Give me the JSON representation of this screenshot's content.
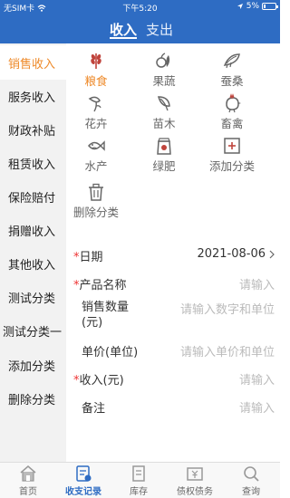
{
  "status_bar": {
    "carrier": "无SIM卡",
    "time": "下午5:20",
    "battery": "5%"
  },
  "header": {
    "tabs": [
      {
        "label": "收入",
        "active": true
      },
      {
        "label": "支出",
        "active": false
      }
    ]
  },
  "sidebar": {
    "items": [
      {
        "label": "销售收入",
        "active": true
      },
      {
        "label": "服务收入"
      },
      {
        "label": "财政补贴"
      },
      {
        "label": "租赁收入"
      },
      {
        "label": "保险赔付"
      },
      {
        "label": "捐赠收入"
      },
      {
        "label": "其他收入"
      },
      {
        "label": "测试分类"
      },
      {
        "label": "测试分类一"
      },
      {
        "label": "添加分类"
      },
      {
        "label": "删除分类"
      }
    ]
  },
  "categories": [
    {
      "label": "粮食",
      "icon": "grain-icon",
      "active": true
    },
    {
      "label": "果蔬",
      "icon": "fruit-vegetable-icon"
    },
    {
      "label": "蚕桑",
      "icon": "silkworm-icon"
    },
    {
      "label": "花卉",
      "icon": "flower-icon"
    },
    {
      "label": "苗木",
      "icon": "seedling-icon"
    },
    {
      "label": "畜禽",
      "icon": "poultry-icon"
    },
    {
      "label": "水产",
      "icon": "fish-icon"
    },
    {
      "label": "绿肥",
      "icon": "fertilizer-icon"
    },
    {
      "label": "添加分类",
      "icon": "add-category-icon"
    },
    {
      "label": "删除分类",
      "icon": "delete-category-icon"
    }
  ],
  "form": {
    "date": {
      "label": "日期",
      "value": "2021-08-06"
    },
    "product_name": {
      "label": "产品名称",
      "placeholder": "请输入"
    },
    "quantity": {
      "label_line1": "销售数量",
      "label_line2": "(元)",
      "placeholder": "请输入数字和单位"
    },
    "unit_price": {
      "label": "单价(单位)",
      "placeholder": "请输入单价和单位"
    },
    "income": {
      "label": "收入(元)",
      "placeholder": "请输入"
    },
    "remark": {
      "label": "备注",
      "placeholder": "请输入"
    },
    "required_mark": "*"
  },
  "tabbar": {
    "items": [
      {
        "label": "首页",
        "icon": "home-icon"
      },
      {
        "label": "收支记录",
        "icon": "ledger-icon",
        "active": true
      },
      {
        "label": "库存",
        "icon": "inventory-icon"
      },
      {
        "label": "债权债务",
        "icon": "debt-icon"
      },
      {
        "label": "查询",
        "icon": "search-icon"
      }
    ]
  },
  "colors": {
    "primary": "#2e6cc3",
    "accent": "#ee8a2a",
    "icon_red": "#c0443c",
    "icon_gray": "#666666"
  }
}
